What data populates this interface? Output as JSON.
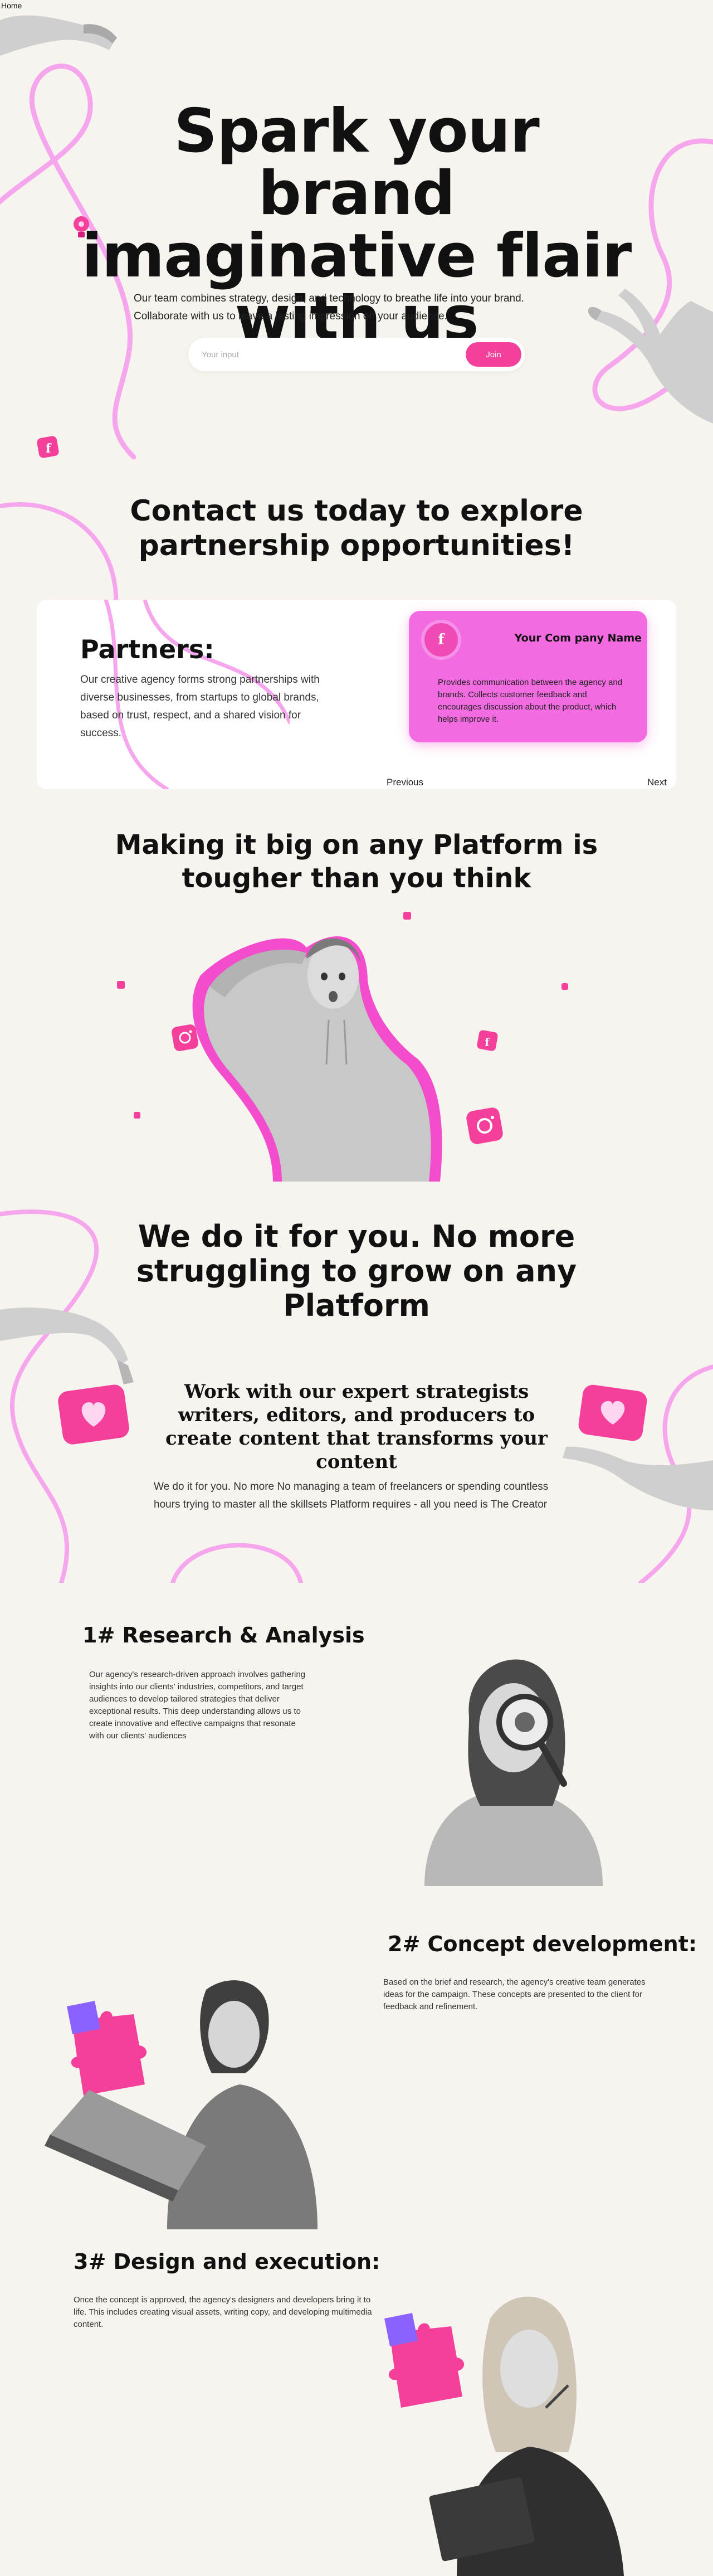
{
  "nav": {
    "home": "Home"
  },
  "hero": {
    "title": "Spark your brand imaginative flair with us",
    "subtitle": "Our team combines strategy, design, and technology to breathe life into your brand. Collaborate with us to leave a lasting impression on your audience.",
    "input_placeholder": "Your input",
    "join_label": "Join"
  },
  "contact": {
    "title": "Contact us today to explore partnership opportunities!",
    "partners_heading": "Partners:",
    "partners_text": "Our creative agency forms strong partnerships with diverse businesses, from startups to global brands, based on trust, respect, and a shared vision for success.",
    "company_name": "Your Com pany Name",
    "company_logo_letter": "f",
    "company_desc": "Provides communication between the agency and brands. Collects customer feedback and encourages discussion about the product, which helps improve it.",
    "prev_label": "Previous",
    "next_label": "Next"
  },
  "platform": {
    "title": "Making it big on any Platform is tougher than you think"
  },
  "wedo": {
    "title": "We do it for you. No more struggling to grow on any Platform",
    "work_title": "Work with our expert strategists writers, editors, and producers to create content that transforms your content",
    "text": "We do it for you. No more No managing a team of freelancers or spending countless hours trying to master all the skillsets Platform requires - all you need is The Creator"
  },
  "steps": [
    {
      "title": "1# Research & Analysis",
      "text": "Our agency's research-driven approach involves gathering insights into our clients' industries, competitors, and target audiences to develop tailored strategies that deliver exceptional results. This deep understanding allows us to create innovative and effective campaigns that resonate with our clients' audiences"
    },
    {
      "title": "2# Concept development:",
      "text": "Based on the brief and research, the agency's creative team generates ideas for the campaign. These concepts are presented to the client for feedback and refinement."
    },
    {
      "title": "3# Design and execution:",
      "text": "Once the concept is approved, the agency's designers and developers bring it to life. This includes creating visual assets, writing copy, and developing multimedia content."
    }
  ],
  "colors": {
    "accent": "#f4409a",
    "card_pink": "#f36be0",
    "line_pink": "#f6a6ec",
    "background": "#f7f4ef"
  },
  "icons": [
    "facebook-icon",
    "lightbulb-icon",
    "instagram-icon",
    "heart-icon",
    "puzzle-icon"
  ]
}
